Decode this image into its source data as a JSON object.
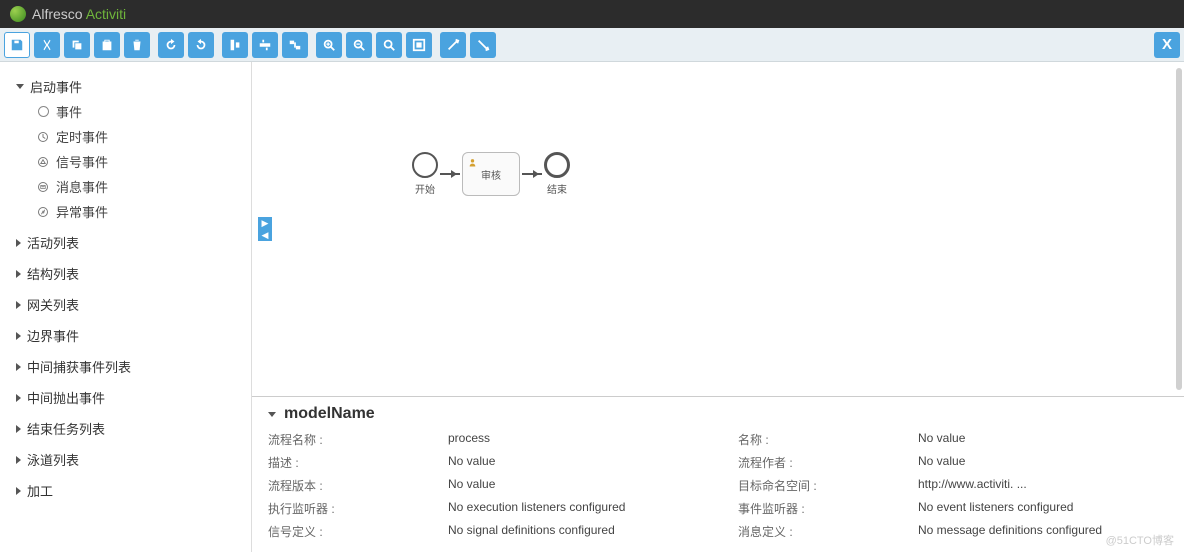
{
  "brand": {
    "name": "Alfresco",
    "product": "Activiti"
  },
  "close_label": "X",
  "sidebar": {
    "categories": [
      {
        "label": "启动事件",
        "open": true,
        "items": [
          {
            "label": "事件",
            "ico": "circle"
          },
          {
            "label": "定时事件",
            "ico": "timer"
          },
          {
            "label": "信号事件",
            "ico": "signal"
          },
          {
            "label": "消息事件",
            "ico": "message"
          },
          {
            "label": "异常事件",
            "ico": "error"
          }
        ]
      },
      {
        "label": "活动列表",
        "open": false
      },
      {
        "label": "结构列表",
        "open": false
      },
      {
        "label": "网关列表",
        "open": false
      },
      {
        "label": "边界事件",
        "open": false
      },
      {
        "label": "中间捕获事件列表",
        "open": false
      },
      {
        "label": "中间抛出事件",
        "open": false
      },
      {
        "label": "结束任务列表",
        "open": false
      },
      {
        "label": "泳道列表",
        "open": false
      },
      {
        "label": "加工",
        "open": false
      }
    ]
  },
  "diagram": {
    "start": "开始",
    "task": "审核",
    "end": "结束"
  },
  "nav_arrows": {
    "right": "▶",
    "left": "◀"
  },
  "props": {
    "title": "modelName",
    "rows": [
      {
        "l1": "流程名称 :",
        "v1": "process",
        "l2": "名称 :",
        "v2": "No value"
      },
      {
        "l1": "描述 :",
        "v1": "No value",
        "l2": "流程作者 :",
        "v2": "No value"
      },
      {
        "l1": "流程版本 :",
        "v1": "No value",
        "l2": "目标命名空间 :",
        "v2": "http://www.activiti. ..."
      },
      {
        "l1": "执行监听器 :",
        "v1": "No execution listeners configured",
        "l2": "事件监听器 :",
        "v2": "No event listeners configured"
      },
      {
        "l1": "信号定义 :",
        "v1": "No signal definitions configured",
        "l2": "消息定义 :",
        "v2": "No message definitions configured"
      }
    ]
  },
  "watermark": "@51CTO博客"
}
